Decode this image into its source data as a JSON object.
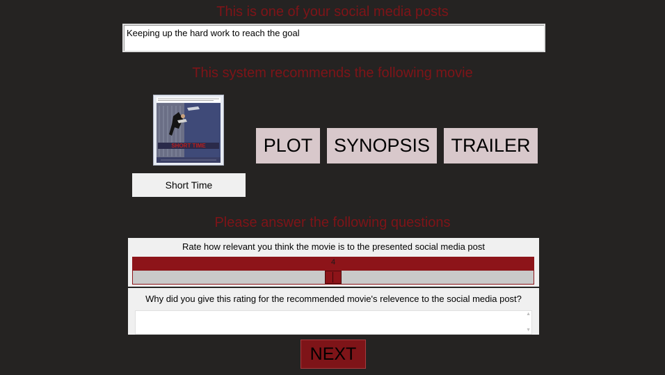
{
  "headings": {
    "post": "This is one of your social media posts",
    "recommend": "This system recommends the following movie",
    "questions": "Please answer the following questions"
  },
  "post": {
    "text": "Keeping up the hard work to reach the goal"
  },
  "movie": {
    "title": "Short Time",
    "poster_title": "SHORT TIME",
    "poster_icon": "movie-poster-image"
  },
  "buttons": {
    "plot": "PLOT",
    "synopsis": "SYNOPSIS",
    "trailer": "TRAILER",
    "next": "NEXT"
  },
  "questions": {
    "relevance_label": "Rate how relevant you think the movie is to the presented social media post",
    "relevance_value": "4",
    "relevance_level": 4,
    "why_label": "Why did you give this rating for the recommended movie's relevence to the social media post?",
    "why_value": ""
  },
  "colors": {
    "background": "#252322",
    "accent_red": "#7e1418",
    "button_pink": "#d8c8cb"
  }
}
